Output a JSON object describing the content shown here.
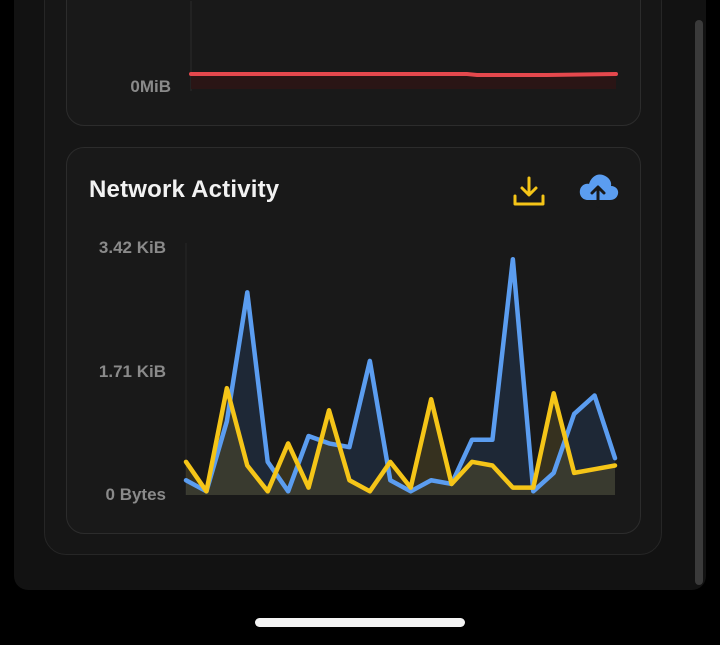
{
  "memory_card": {
    "y_label": "0MiB",
    "line_color": "#e5484d"
  },
  "network_card": {
    "title": "Network Activity",
    "download_icon": "download-icon",
    "upload_icon": "cloud-upload-icon",
    "download_color": "#f5c518",
    "upload_color": "#5b9df0"
  },
  "chart_data": {
    "type": "area",
    "title": "Network Activity",
    "y_tick_labels": [
      "3.42 KiB",
      "1.71 KiB",
      "0 Bytes"
    ],
    "ylim": [
      0,
      3.42
    ],
    "y_unit": "KiB",
    "series": [
      {
        "color": "#5b9df0",
        "values": [
          0.2,
          0.05,
          1.0,
          2.75,
          0.45,
          0.05,
          0.8,
          0.7,
          0.65,
          1.82,
          0.2,
          0.05,
          0.2,
          0.15,
          0.75,
          0.75,
          3.2,
          0.05,
          0.3,
          1.1,
          1.35,
          0.5
        ]
      },
      {
        "color": "#f5c518",
        "values": [
          0.45,
          0.05,
          1.45,
          0.4,
          0.05,
          0.7,
          0.1,
          1.15,
          0.2,
          0.05,
          0.45,
          0.1,
          1.3,
          0.15,
          0.45,
          0.4,
          0.1,
          0.1,
          1.38,
          0.3,
          0.35,
          0.4
        ]
      }
    ]
  }
}
